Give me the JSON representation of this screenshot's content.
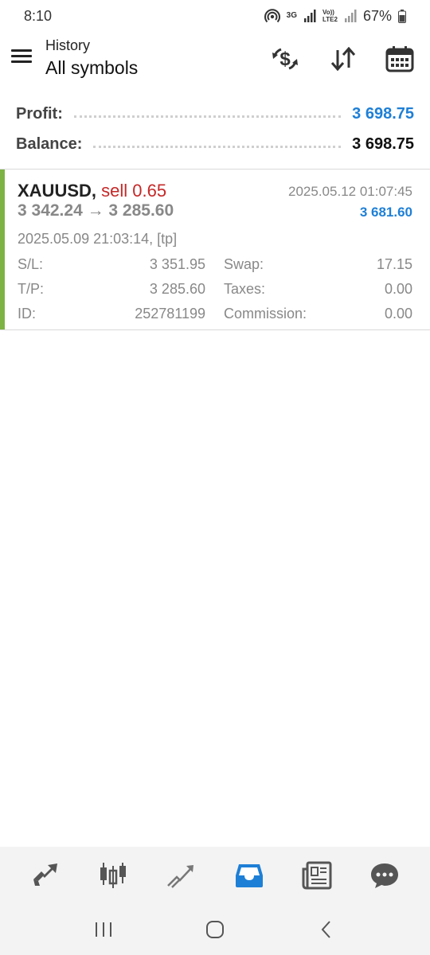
{
  "status_bar": {
    "time": "8:10",
    "network_3g": "3G",
    "volte_top": "Vo))",
    "volte_bottom": "LTE2",
    "battery": "67%"
  },
  "app_bar": {
    "subtitle": "History",
    "title": "All symbols",
    "icons": [
      "menu-icon",
      "currency-exchange-icon",
      "sort-icon",
      "calendar-icon"
    ]
  },
  "summary": {
    "profit_label": "Profit:",
    "profit_value": "3 698.75",
    "balance_label": "Balance:",
    "balance_value": "3 698.75"
  },
  "trade": {
    "symbol": "XAUUSD,",
    "side": "sell 0.65",
    "prices": "3 342.24 → 3 285.60",
    "close_time": "2025.05.12 01:07:45",
    "profit": "3 681.60",
    "open_time": "2025.05.09 21:03:14, [tp]",
    "sl_label": "S/L:",
    "sl_value": "3 351.95",
    "tp_label": "T/P:",
    "tp_value": "3 285.60",
    "id_label": "ID:",
    "id_value": "252781199",
    "swap_label": "Swap:",
    "swap_value": "17.15",
    "taxes_label": "Taxes:",
    "taxes_value": "0.00",
    "commission_label": "Commission:",
    "commission_value": "0.00"
  },
  "bottom_nav": {
    "items": [
      "quotes-icon",
      "chart-icon",
      "trade-icon",
      "history-icon",
      "news-icon",
      "messages-icon"
    ],
    "active": "history-icon"
  },
  "colors": {
    "accent_blue": "#1e7fd6",
    "sell_red": "#c62828",
    "profit_green_bar": "#7cb342"
  }
}
